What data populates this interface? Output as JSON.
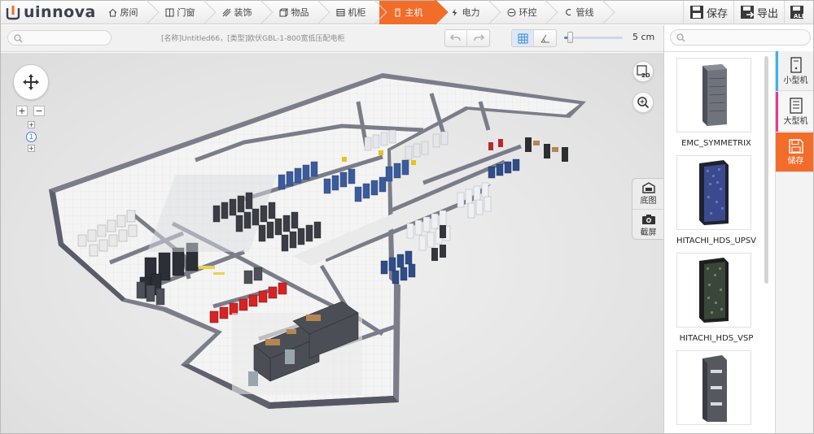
{
  "app": {
    "logo_text": "uinnova"
  },
  "nav": {
    "tabs": [
      {
        "label": "房间",
        "icon": "house-icon",
        "active": false
      },
      {
        "label": "门窗",
        "icon": "window-icon",
        "active": false
      },
      {
        "label": "装饰",
        "icon": "hatch-icon",
        "active": false
      },
      {
        "label": "物品",
        "icon": "cube-icon",
        "active": false
      },
      {
        "label": "机柜",
        "icon": "rack-icon",
        "active": false
      },
      {
        "label": "主机",
        "icon": "server-icon",
        "active": true
      },
      {
        "label": "电力",
        "icon": "lightning-icon",
        "active": false
      },
      {
        "label": "环控",
        "icon": "thermometer-icon",
        "active": false
      },
      {
        "label": "管线",
        "icon": "pipe-icon",
        "active": false
      }
    ],
    "actions": [
      {
        "label": "保存",
        "icon": "save-icon"
      },
      {
        "label": "导出",
        "icon": "export-icon"
      },
      {
        "label": "ALL",
        "icon": "all-icon"
      }
    ]
  },
  "toolbar": {
    "document_title": "[名称]Untitled66，[类型]欧伏GBL-1-800宽低压配电柜",
    "scale_label": "5 cm",
    "zoom_fraction": 0.1
  },
  "viewport": {
    "level": "1",
    "view_2d_label": "2D",
    "dock": [
      {
        "label": "底图",
        "icon": "floorplan-icon"
      },
      {
        "label": "截屏",
        "icon": "camera-icon"
      }
    ]
  },
  "panel": {
    "items": [
      {
        "label": "EMC_SYMMETRIX",
        "icon": "emc-server-icon"
      },
      {
        "label": "HITACHI_HDS_UPSV",
        "icon": "hds-upsv-server-icon"
      },
      {
        "label": "HITACHI_HDS_VSP",
        "icon": "hds-vsp-server-icon"
      },
      {
        "label": "",
        "icon": "server-tower-icon"
      }
    ],
    "categories": [
      {
        "label": "小型机",
        "accent": "#3bb3e6"
      },
      {
        "label": "大型机",
        "accent": "#e63b8a"
      },
      {
        "label": "储存",
        "accent": "#f26d2a"
      }
    ]
  },
  "colors": {
    "accent": "#f26d2a",
    "active_tab": "#f26d2a",
    "link_blue": "#3a86d8"
  }
}
